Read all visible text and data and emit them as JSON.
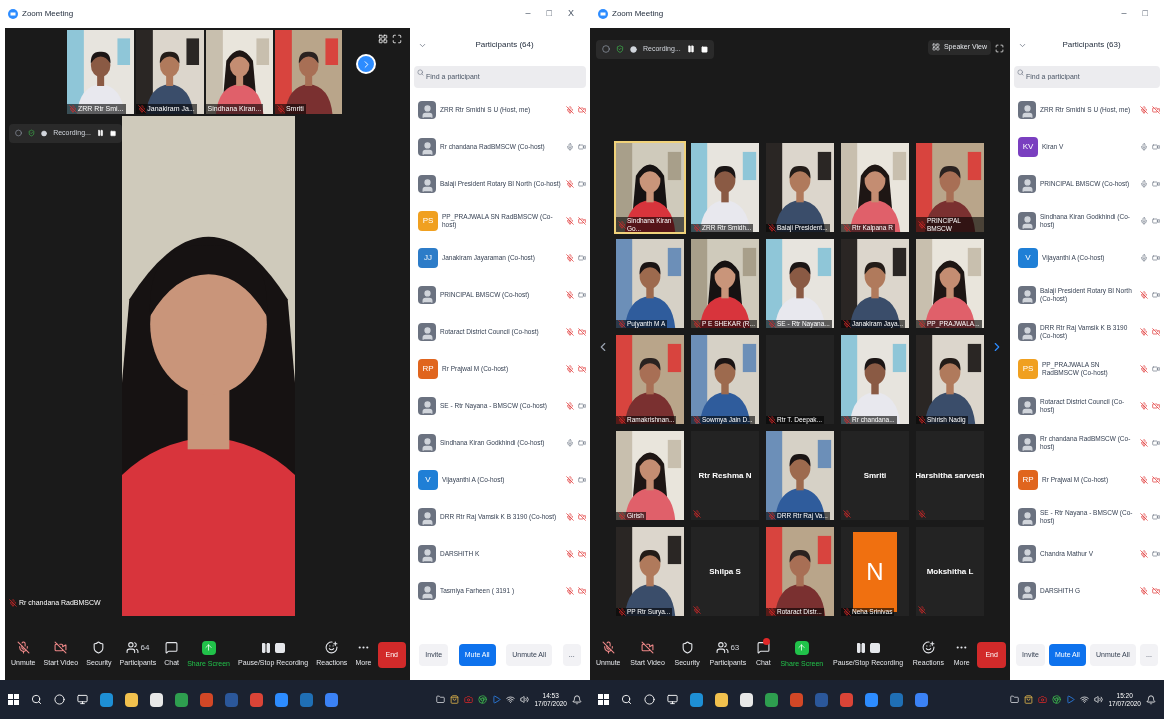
{
  "screens": [
    {
      "window": {
        "title": "Zoom Meeting",
        "controls": [
          "–",
          "□",
          "X"
        ]
      },
      "top_strip": [
        {
          "name": "ZRR Rtr Smi...",
          "muted": true
        },
        {
          "name": "Janakiram Ja...",
          "muted": true
        },
        {
          "name": "Sindhana Kiran...",
          "muted": false
        },
        {
          "name": "Smriti",
          "muted": true
        }
      ],
      "recording": "Recording...",
      "speaker": {
        "name": "Rr chandana RadBMSCW"
      },
      "participants_panel": {
        "title": "Participants (64)",
        "search_placeholder": "Find a participant",
        "items": [
          {
            "name": "ZRR Rtr Smidhi S U (Host, me)",
            "muted": true,
            "video": false
          },
          {
            "name": "Rr chandana RadBMSCW (Co-host)",
            "muted": false,
            "video": true
          },
          {
            "name": "Balaji President Rotary BI North (Co-host)",
            "muted": true,
            "video": true
          },
          {
            "name": "PP_PRAJWALA SN RadBMSCW (Co-host)",
            "avatar": {
              "kind": "initials",
              "text": "PS",
              "color": "#f0a020"
            },
            "muted": true,
            "video": false
          },
          {
            "name": "Janakiram Jayaraman (Co-host)",
            "avatar": {
              "kind": "initials",
              "text": "JJ",
              "color": "#2d7cc8"
            },
            "muted": true,
            "video": true
          },
          {
            "name": "PRINCIPAL BMSCW (Co-host)",
            "muted": true,
            "video": true
          },
          {
            "name": "Rotaract District Council (Co-host)",
            "muted": true,
            "video": false
          },
          {
            "name": "Rr Prajwal M (Co-host)",
            "avatar": {
              "kind": "initials",
              "text": "RP",
              "color": "#e0651e"
            },
            "muted": true,
            "video": false
          },
          {
            "name": "SE - Rtr Nayana - BMSCW (Co-host)",
            "muted": true,
            "video": true
          },
          {
            "name": "Sindhana Kiran Godkhindi (Co-host)",
            "muted": false,
            "video": true
          },
          {
            "name": "Vijayanthi A (Co-host)",
            "avatar": {
              "kind": "initials",
              "text": "V",
              "color": "#1f7fd6"
            },
            "muted": true,
            "video": true
          },
          {
            "name": "DRR Rtr Raj Vamsik K B 3190 (Co-host)",
            "muted": true,
            "video": false
          },
          {
            "name": "DARSHITH K",
            "muted": true,
            "video": false
          },
          {
            "name": "Tasmiya Farheen ( 3191 )",
            "muted": true,
            "video": false
          }
        ],
        "buttons": [
          {
            "label": "Invite",
            "primary": false
          },
          {
            "label": "Mute All",
            "primary": true
          },
          {
            "label": "Unmute All",
            "primary": false
          },
          {
            "label": "...",
            "primary": false
          }
        ]
      },
      "toolbar": [
        {
          "label": "Unmute",
          "kind": "mic"
        },
        {
          "label": "Start Video",
          "kind": "video"
        },
        {
          "label": "Security",
          "kind": "security"
        },
        {
          "label": "Participants",
          "kind": "participants",
          "count": "64"
        },
        {
          "label": "Chat",
          "kind": "chat",
          "badge": false
        },
        {
          "label": "Share Screen",
          "kind": "share"
        },
        {
          "label": "Pause/Stop Recording",
          "kind": "record"
        },
        {
          "label": "Reactions",
          "kind": "reactions"
        },
        {
          "label": "More",
          "kind": "more"
        }
      ],
      "end": "End",
      "taskbar": {
        "time": "14:53",
        "date": "17/07/2020"
      }
    },
    {
      "window": {
        "title": "Zoom Meeting",
        "controls": [
          "–",
          "□"
        ]
      },
      "recording": "Recording...",
      "view_button": "Speaker View",
      "gallery": [
        {
          "name": "Sindhana Kiran Go...",
          "kind": "video",
          "active": true
        },
        {
          "name": "ZRR Rtr Smidh...",
          "kind": "video",
          "active": false
        },
        {
          "name": "Balaji President...",
          "kind": "video",
          "active": false
        },
        {
          "name": "Rtr Kalpana R",
          "kind": "video",
          "active": false
        },
        {
          "name": "PRINCIPAL BMSCW",
          "kind": "video",
          "active": false
        },
        {
          "name": "Pujyanth M A",
          "kind": "video",
          "active": false
        },
        {
          "name": "P E SHEKAR (R...",
          "kind": "video",
          "active": false
        },
        {
          "name": "SE - Rtr Nayana...",
          "kind": "video",
          "active": false
        },
        {
          "name": "Janakiram Jaya...",
          "kind": "video",
          "active": false
        },
        {
          "name": "PP_PRAJWALA...",
          "kind": "video",
          "active": false
        },
        {
          "name": "Ramakrishnan...",
          "kind": "video",
          "active": false
        },
        {
          "name": "Sowmya Jain D...",
          "kind": "video",
          "active": false
        },
        {
          "name": "Rtr T. Deepak...",
          "kind": "blank",
          "active": false
        },
        {
          "name": "Rr chandana...",
          "kind": "video",
          "active": false
        },
        {
          "name": "Shirish Nadig",
          "kind": "video",
          "active": false
        },
        {
          "name": "Girish",
          "kind": "video",
          "active": false
        },
        {
          "name": "Rtr Reshma N",
          "kind": "name",
          "active": false
        },
        {
          "name": "DRR Rtr Raj Va...",
          "kind": "video",
          "active": false
        },
        {
          "name": "Smriti",
          "kind": "name",
          "active": false
        },
        {
          "name": "Harshitha sarvesh",
          "kind": "name",
          "active": false
        },
        {
          "name": "PP Rtr Surya...",
          "kind": "video",
          "active": false
        },
        {
          "name": "Shilpa S",
          "kind": "name",
          "active": false
        },
        {
          "name": "Rotaract Distr...",
          "kind": "video",
          "active": false
        },
        {
          "name": "Neha Srinivas",
          "kind": "letter",
          "letter": "N",
          "active": false
        },
        {
          "name": "Mokshitha L",
          "kind": "name",
          "active": false
        }
      ],
      "participants_panel": {
        "title": "Participants (63)",
        "search_placeholder": "Find a participant",
        "items": [
          {
            "name": "ZRR Rtr Smidhi S U (Host, me)",
            "muted": true,
            "video": false
          },
          {
            "name": "Kiran V",
            "avatar": {
              "kind": "initials",
              "text": "KV",
              "color": "#7a3fc0"
            },
            "muted": false,
            "video": true
          },
          {
            "name": "PRINCIPAL BMSCW (Co-host)",
            "muted": false,
            "video": true
          },
          {
            "name": "Sindhana Kiran Godkhindi (Co-host)",
            "muted": false,
            "video": true
          },
          {
            "name": "Vijayanthi A (Co-host)",
            "avatar": {
              "kind": "initials",
              "text": "V",
              "color": "#1f7fd6"
            },
            "muted": false,
            "video": true
          },
          {
            "name": "Balaji President Rotary BI North (Co-host)",
            "muted": true,
            "video": true
          },
          {
            "name": "DRR Rtr Raj Vamsik K B 3190 (Co-host)",
            "muted": true,
            "video": false
          },
          {
            "name": "PP_PRAJWALA SN RadBMSCW (Co-host)",
            "avatar": {
              "kind": "initials",
              "text": "PS",
              "color": "#f0a020"
            },
            "muted": true,
            "video": true
          },
          {
            "name": "Rotaract District Council (Co-host)",
            "muted": true,
            "video": false
          },
          {
            "name": "Rr chandana RadBMSCW (Co-host)",
            "muted": true,
            "video": true
          },
          {
            "name": "Rr Prajwal M (Co-host)",
            "avatar": {
              "kind": "initials",
              "text": "RP",
              "color": "#e0651e"
            },
            "muted": true,
            "video": false
          },
          {
            "name": "SE - Rtr Nayana - BMSCW (Co-host)",
            "muted": true,
            "video": true
          },
          {
            "name": "Chandra Mathur V",
            "muted": true,
            "video": true
          },
          {
            "name": "DARSHITH G",
            "muted": true,
            "video": false
          }
        ],
        "buttons": [
          {
            "label": "Invite",
            "primary": false
          },
          {
            "label": "Mute All",
            "primary": true
          },
          {
            "label": "Unmute All",
            "primary": false
          },
          {
            "label": "...",
            "primary": false
          }
        ]
      },
      "toolbar": [
        {
          "label": "Unmute",
          "kind": "mic"
        },
        {
          "label": "Start Video",
          "kind": "video"
        },
        {
          "label": "Security",
          "kind": "security"
        },
        {
          "label": "Participants",
          "kind": "participants",
          "count": "63"
        },
        {
          "label": "Chat",
          "kind": "chat",
          "badge": true
        },
        {
          "label": "Share Screen",
          "kind": "share"
        },
        {
          "label": "Pause/Stop Recording",
          "kind": "record"
        },
        {
          "label": "Reactions",
          "kind": "reactions"
        },
        {
          "label": "More",
          "kind": "more"
        }
      ],
      "end": "End",
      "taskbar": {
        "time": "15:20",
        "date": "17/07/2020"
      }
    }
  ]
}
